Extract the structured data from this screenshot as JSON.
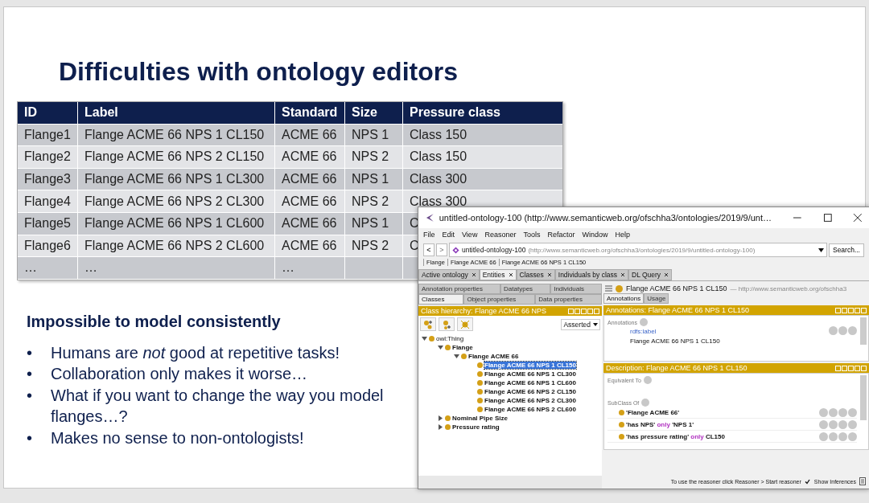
{
  "slide": {
    "title": "Difficulties with ontology editors",
    "table": {
      "columns": [
        "ID",
        "Label",
        "Standard",
        "Size",
        "Pressure class"
      ],
      "rows": [
        [
          "Flange1",
          "Flange ACME 66 NPS 1 CL150",
          "ACME 66",
          "NPS 1",
          "Class 150"
        ],
        [
          "Flange2",
          "Flange ACME 66 NPS 2 CL150",
          "ACME 66",
          "NPS 2",
          "Class 150"
        ],
        [
          "Flange3",
          "Flange ACME 66 NPS 1 CL300",
          "ACME 66",
          "NPS 1",
          "Class 300"
        ],
        [
          "Flange4",
          "Flange ACME 66 NPS 2 CL300",
          "ACME 66",
          "NPS 2",
          "Class 300"
        ],
        [
          "Flange5",
          "Flange ACME 66 NPS 1 CL600",
          "ACME 66",
          "NPS 1",
          "C"
        ],
        [
          "Flange6",
          "Flange ACME 66 NPS 2 CL600",
          "ACME 66",
          "NPS 2",
          "C"
        ],
        [
          "…",
          "…",
          "…",
          "",
          ""
        ]
      ]
    },
    "heading": "Impossible to model consistently",
    "bullet_mark": "•",
    "bullets": [
      "Humans are *not* good at repetitive tasks!",
      "Collaboration only makes it worse…",
      "What if you want to change the way you model flanges…?",
      "Makes no sense to non-ontologists!"
    ]
  },
  "protege": {
    "title": "untitled-ontology-100 (http://www.semanticweb.org/ofschha3/ontologies/2019/9/unt…",
    "menu": [
      "File",
      "Edit",
      "View",
      "Reasoner",
      "Tools",
      "Refactor",
      "Window",
      "Help"
    ],
    "back": "<",
    "forward": ">",
    "ontology_name": "untitled-ontology-100",
    "ontology_iri": "(http://www.semanticweb.org/ofschha3/ontologies/2019/9/untitled-ontology-100)",
    "search_button": "Search...",
    "breadcrumb": [
      "Flange",
      "Flange ACME 66",
      "Flange ACME 66 NPS 1 CL150"
    ],
    "tabs": [
      {
        "label": "Active ontology",
        "selected": false
      },
      {
        "label": "Entities",
        "selected": true
      },
      {
        "label": "Classes",
        "selected": false
      },
      {
        "label": "Individuals by class",
        "selected": false
      },
      {
        "label": "DL Query",
        "selected": false
      }
    ],
    "left_tabs": [
      [
        {
          "label": "Annotation properties",
          "selected": false
        },
        {
          "label": "Datatypes",
          "selected": false
        },
        {
          "label": "Individuals",
          "selected": false
        }
      ],
      [
        {
          "label": "Classes",
          "selected": true
        },
        {
          "label": "Object properties",
          "selected": false
        },
        {
          "label": "Data properties",
          "selected": false
        }
      ]
    ],
    "hierarchy_title": "Class hierarchy: Flange ACME 66 NPS",
    "hierarchy_mode": "Asserted",
    "tree": [
      {
        "label": "owl:Thing",
        "expanded": true,
        "selected": false,
        "children": [
          {
            "label": "Flange",
            "expanded": true,
            "selected": false,
            "children": [
              {
                "label": "Flange ACME 66",
                "expanded": true,
                "selected": false,
                "children": [
                  {
                    "label": "Flange ACME 66 NPS 1 CL150",
                    "selected": true
                  },
                  {
                    "label": "Flange ACME 66 NPS 1 CL300",
                    "selected": false
                  },
                  {
                    "label": "Flange ACME 66 NPS 1 CL600",
                    "selected": false
                  },
                  {
                    "label": "Flange ACME 66 NPS 2 CL150",
                    "selected": false
                  },
                  {
                    "label": "Flange ACME 66 NPS 2 CL300",
                    "selected": false
                  },
                  {
                    "label": "Flange ACME 66 NPS 2 CL600",
                    "selected": false
                  }
                ]
              }
            ]
          },
          {
            "label": "Nominal Pipe Size",
            "expanded": false,
            "selected": false
          },
          {
            "label": "Pressure rating",
            "expanded": false,
            "selected": false
          }
        ]
      }
    ],
    "entity_title": "Flange ACME 66 NPS 1 CL150",
    "entity_iri": "— http://www.semanticweb.org/ofschha3",
    "right_tabs": [
      {
        "label": "Annotations",
        "selected": true
      },
      {
        "label": "Usage",
        "selected": false
      }
    ],
    "annotations_panel": {
      "title": "Annotations: Flange ACME 66 NPS 1 CL150",
      "section": "Annotations",
      "property": "rdfs:label",
      "value": "Flange ACME 66 NPS 1 CL150"
    },
    "description_panel": {
      "title": "Description: Flange ACME 66 NPS 1 CL150",
      "equivalent": "Equivalent To",
      "subclass": "SubClass Of",
      "axioms": [
        [
          {
            "kind": "name",
            "text": "'Flange ACME 66'"
          }
        ],
        [
          {
            "kind": "name",
            "text": "'has NPS' "
          },
          {
            "kind": "keyword",
            "text": "only"
          },
          {
            "kind": "name",
            "text": " 'NPS 1'"
          }
        ],
        [
          {
            "kind": "name",
            "text": "'has pressure rating' "
          },
          {
            "kind": "keyword",
            "text": "only"
          },
          {
            "kind": "name",
            "text": " CL150"
          }
        ]
      ]
    },
    "status": "To use the reasoner click Reasoner > Start reasoner",
    "show_inferences": {
      "label": "Show Inferences",
      "checked": true
    }
  }
}
